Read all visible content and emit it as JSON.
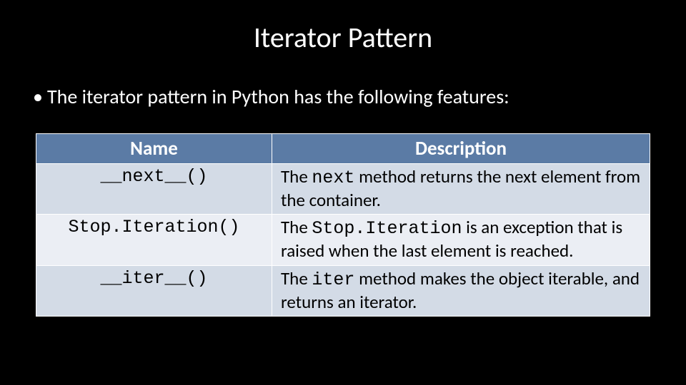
{
  "title": "Iterator Pattern",
  "bullet": "The iterator pattern in Python has the following features:",
  "table": {
    "headers": {
      "name": "Name",
      "desc": "Description"
    },
    "rows": [
      {
        "name": "__next__()",
        "desc_pre": "The ",
        "desc_code": "next",
        "desc_post": " method returns the next element from the container."
      },
      {
        "name": "Stop.Iteration()",
        "desc_pre": "The ",
        "desc_code": "Stop.Iteration",
        "desc_post": " is an exception that is raised when the last element is reached."
      },
      {
        "name": "__iter__()",
        "desc_pre": "The ",
        "desc_code": "iter",
        "desc_post": " method makes the object iterable, and returns an iterator."
      }
    ]
  }
}
